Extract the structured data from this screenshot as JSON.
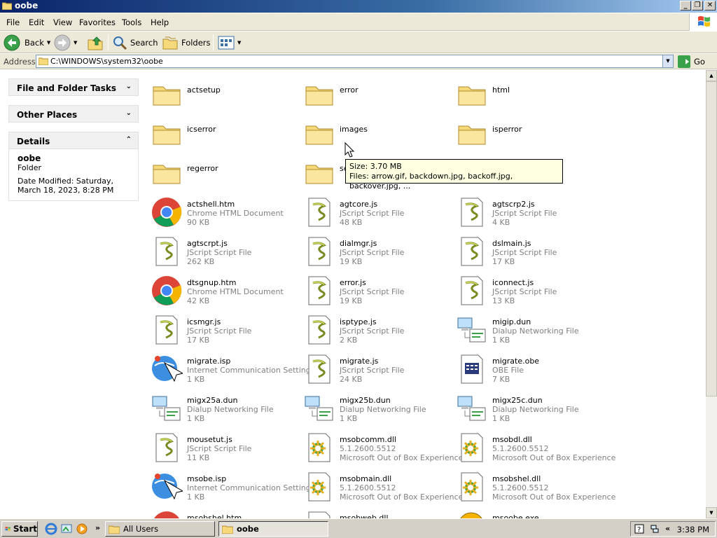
{
  "window": {
    "title": "oobe"
  },
  "menu": [
    "File",
    "Edit",
    "View",
    "Favorites",
    "Tools",
    "Help"
  ],
  "toolbar": {
    "back": "Back",
    "search": "Search",
    "folders": "Folders"
  },
  "address": {
    "label": "Address",
    "path": "C:\\WINDOWS\\system32\\oobe",
    "go": "Go"
  },
  "taskpane": {
    "file_tasks": "File and Folder Tasks",
    "other_places": "Other Places",
    "details": {
      "title": "Details",
      "name": "oobe",
      "type": "Folder",
      "modified": "Date Modified: Saturday, March 18, 2023, 8:28 PM"
    }
  },
  "items": [
    {
      "name": "actsetup",
      "icon": "folder"
    },
    {
      "name": "error",
      "icon": "folder"
    },
    {
      "name": "html",
      "icon": "folder"
    },
    {
      "name": "icserror",
      "icon": "folder"
    },
    {
      "name": "images",
      "icon": "folder"
    },
    {
      "name": "isperror",
      "icon": "folder"
    },
    {
      "name": "regerror",
      "icon": "folder"
    },
    {
      "name": "se",
      "icon": "folder"
    },
    {
      "name": "",
      "icon": "none"
    },
    {
      "name": "actshell.htm",
      "type": "Chrome HTML Document",
      "size": "90 KB",
      "icon": "chrome"
    },
    {
      "name": "agtcore.js",
      "type": "JScript Script File",
      "size": "48 KB",
      "icon": "script"
    },
    {
      "name": "agtscrp2.js",
      "type": "JScript Script File",
      "size": "4 KB",
      "icon": "script"
    },
    {
      "name": "agtscrpt.js",
      "type": "JScript Script File",
      "size": "262 KB",
      "icon": "script"
    },
    {
      "name": "dialmgr.js",
      "type": "JScript Script File",
      "size": "19 KB",
      "icon": "script"
    },
    {
      "name": "dslmain.js",
      "type": "JScript Script File",
      "size": "17 KB",
      "icon": "script"
    },
    {
      "name": "dtsgnup.htm",
      "type": "Chrome HTML Document",
      "size": "42 KB",
      "icon": "chrome"
    },
    {
      "name": "error.js",
      "type": "JScript Script File",
      "size": "19 KB",
      "icon": "script"
    },
    {
      "name": "iconnect.js",
      "type": "JScript Script File",
      "size": "13 KB",
      "icon": "script"
    },
    {
      "name": "icsmgr.js",
      "type": "JScript Script File",
      "size": "17 KB",
      "icon": "script"
    },
    {
      "name": "isptype.js",
      "type": "JScript Script File",
      "size": "2 KB",
      "icon": "script"
    },
    {
      "name": "migip.dun",
      "type": "Dialup Networking File",
      "size": "1 KB",
      "icon": "network"
    },
    {
      "name": "migrate.isp",
      "type": "Internet Communication Settings",
      "size": "1 KB",
      "icon": "isp"
    },
    {
      "name": "migrate.js",
      "type": "JScript Script File",
      "size": "24 KB",
      "icon": "script"
    },
    {
      "name": "migrate.obe",
      "type": "OBE File",
      "size": "7 KB",
      "icon": "obe"
    },
    {
      "name": "migx25a.dun",
      "type": "Dialup Networking File",
      "size": "1 KB",
      "icon": "network"
    },
    {
      "name": "migx25b.dun",
      "type": "Dialup Networking File",
      "size": "1 KB",
      "icon": "network"
    },
    {
      "name": "migx25c.dun",
      "type": "Dialup Networking File",
      "size": "1 KB",
      "icon": "network"
    },
    {
      "name": "mousetut.js",
      "type": "JScript Script File",
      "size": "11 KB",
      "icon": "script"
    },
    {
      "name": "msobcomm.dll",
      "type": "5.1.2600.5512",
      "size": "Microsoft Out of Box Experience",
      "icon": "dll"
    },
    {
      "name": "msobdl.dll",
      "type": "5.1.2600.5512",
      "size": "Microsoft Out of Box Experience",
      "icon": "dll"
    },
    {
      "name": "msobe.isp",
      "type": "Internet Communication Settings",
      "size": "1 KB",
      "icon": "isp"
    },
    {
      "name": "msobmain.dll",
      "type": "5.1.2600.5512",
      "size": "Microsoft Out of Box Experience",
      "icon": "dll"
    },
    {
      "name": "msobshel.dll",
      "type": "5.1.2600.5512",
      "size": "Microsoft Out of Box Experience",
      "icon": "dll"
    },
    {
      "name": "msobshel.htm",
      "type": "",
      "size": "",
      "icon": "chrome"
    },
    {
      "name": "msobweb.dll",
      "type": "",
      "size": "",
      "icon": "dll"
    },
    {
      "name": "msoobe.exe",
      "type": "",
      "size": "",
      "icon": "exe"
    }
  ],
  "tooltip": {
    "size": "Size: 3.70 MB",
    "files": "Files: arrow.gif, backdown.jpg, backoff.jpg, backover.jpg, ..."
  },
  "taskbar": {
    "start": "Start",
    "tasks": [
      "All Users",
      "oobe"
    ],
    "clock": "3:38 PM"
  },
  "colors": {
    "titlebar": "#0a246a",
    "folder": "#f6d97a",
    "selection": "#316ac5"
  }
}
